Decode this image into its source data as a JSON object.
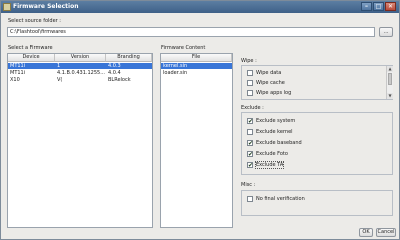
{
  "window": {
    "title": "Firmware Selection"
  },
  "source_folder": {
    "label": "Select source folder :",
    "value": "C:\\Flashtool\\firmwares",
    "browse_label": "..."
  },
  "firmware_list": {
    "label": "Select a Firmware",
    "columns": [
      "Device",
      "Version",
      "Branding"
    ],
    "rows": [
      {
        "device": "MT11i",
        "version": "1",
        "branding": "4.0.3"
      },
      {
        "device": "MT11i",
        "version": "4.1.B.0.431.1255...",
        "branding": "4.0.4"
      },
      {
        "device": "X10",
        "version": "V(",
        "branding": "BLRelock"
      }
    ]
  },
  "firmware_content": {
    "label": "Firmware Content",
    "column": "File",
    "files": [
      "kernel.sin",
      "loader.sin"
    ]
  },
  "wipe": {
    "label": "Wipe :",
    "items": [
      {
        "label": "Wipe data",
        "checked": false
      },
      {
        "label": "Wipe cache",
        "checked": false
      },
      {
        "label": "Wipe apps log",
        "checked": false
      }
    ]
  },
  "exclude": {
    "label": "Exclude :",
    "items": [
      {
        "label": "Exclude system",
        "checked": true
      },
      {
        "label": "Exclude kernel",
        "checked": false
      },
      {
        "label": "Exclude baseband",
        "checked": true
      },
      {
        "label": "Exclude Foto",
        "checked": true
      },
      {
        "label": "Exclude TA",
        "checked": true
      }
    ]
  },
  "misc": {
    "label": "Misc :",
    "items": [
      {
        "label": "No final verification",
        "checked": false
      }
    ]
  },
  "buttons": {
    "ok": "OK",
    "cancel": "Cancel"
  },
  "glyphs": {
    "check": "✔",
    "minimize": "–",
    "maximize": "□",
    "close": "✕",
    "arrow_up": "▲",
    "arrow_down": "▼"
  }
}
